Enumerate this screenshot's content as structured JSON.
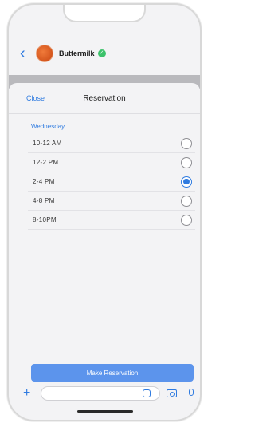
{
  "chat": {
    "name": "Buttermilk",
    "back_icon": "chevron-left-icon",
    "verified_icon": "verified-check-icon"
  },
  "sheet": {
    "close_label": "Close",
    "title": "Reservation",
    "day_label": "Wednesday",
    "slots": [
      {
        "label": "10-12 AM",
        "selected": false
      },
      {
        "label": "12-2 PM",
        "selected": false
      },
      {
        "label": "2-4 PM",
        "selected": true
      },
      {
        "label": "4-8 PM",
        "selected": false
      },
      {
        "label": "8-10PM",
        "selected": false
      }
    ],
    "submit_label": "Make Reservation"
  },
  "input_bar": {
    "icons": [
      "plus-icon",
      "sticker-icon",
      "camera-icon",
      "microphone-icon"
    ]
  },
  "colors": {
    "accent": "#2f7be0",
    "button": "#5c94ec",
    "verified": "#3cc26b"
  }
}
